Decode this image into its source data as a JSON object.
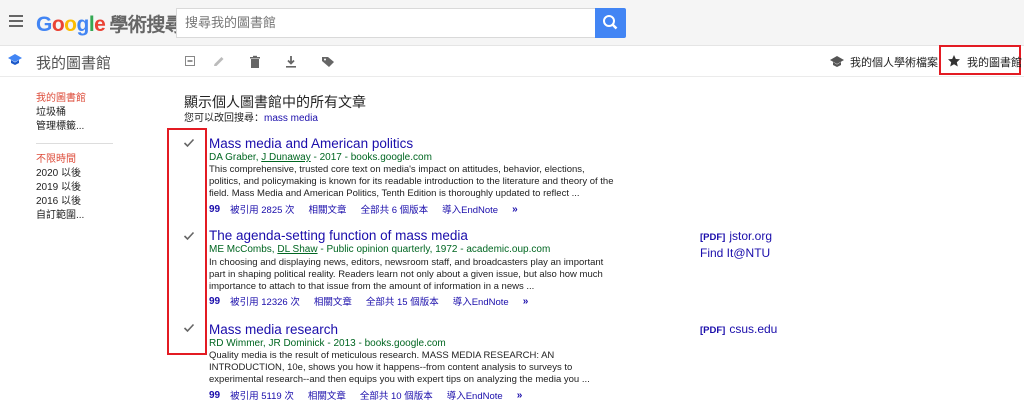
{
  "header": {
    "logo_letters": [
      "G",
      "o",
      "o",
      "g",
      "l",
      "e"
    ],
    "logo_suffix": "學術搜尋",
    "search_placeholder": "搜尋我的圖書館"
  },
  "subbar": {
    "title": "我的圖書館",
    "profile_link": "我的個人學術檔案",
    "mylib_link": "我的圖書館"
  },
  "sidebar": {
    "group1": [
      "我的圖書館",
      "垃圾桶",
      "管理標籤..."
    ],
    "group2": [
      "不限時間",
      "2020 以後",
      "2019 以後",
      "2016 以後",
      "自訂範圍..."
    ]
  },
  "main": {
    "title": "顯示個人圖書館中的所有文章",
    "back_prefix": "您可以改回搜尋：",
    "back_link": "mass media"
  },
  "results": [
    {
      "title": "Mass media and American politics",
      "authors_a": "DA Graber, ",
      "authors_link": "J Dunaway",
      "authors_b": " - 2017 - books.google.com",
      "snippet": "This comprehensive, trusted core text on media's impact on attitudes, behavior, elections, politics, and policymaking is known for its readable introduction to the literature and theory of the field. Mass Media and American Politics, Tenth Edition is thoroughly updated to reflect ...",
      "cited": "被引用 2825 次",
      "related": "相關文章",
      "versions": "全部共 6 個版本",
      "endnote": "導入EndNote",
      "side_pdf": "",
      "side_links": []
    },
    {
      "title": "The agenda-setting function of mass media",
      "authors_a": "ME McCombs, ",
      "authors_link": "DL Shaw",
      "authors_b": " - Public opinion quarterly, 1972 - academic.oup.com",
      "snippet": "In choosing and displaying news, editors, newsroom staff, and broadcasters play an important part in shaping political reality. Readers learn not only about a given issue, but also how much importance to attach to that issue from the amount of information in a news ...",
      "cited": "被引用 12326 次",
      "related": "相關文章",
      "versions": "全部共 15 個版本",
      "endnote": "導入EndNote",
      "side_pdf": "[PDF]",
      "side_links": [
        "jstor.org",
        "Find It@NTU"
      ]
    },
    {
      "title": "Mass media research",
      "authors_a": "RD Wimmer, JR Dominick",
      "authors_link": "",
      "authors_b": " - 2013 - books.google.com",
      "snippet": "Quality media is the result of meticulous research. MASS MEDIA RESEARCH: AN INTRODUCTION, 10e, shows you how it happens--from content analysis to surveys to experimental research--and then equips you with expert tips on analyzing the media you ...",
      "cited": "被引用 5119 次",
      "related": "相關文章",
      "versions": "全部共 10 個版本",
      "endnote": "導入EndNote",
      "side_pdf": "[PDF]",
      "side_links": [
        "csus.edu"
      ]
    }
  ],
  "icons": {
    "link_quote": "99",
    "link_more": "»"
  },
  "colors": {
    "accent_blue": "#4285f4",
    "link": "#1a0dab",
    "green": "#006621",
    "red_highlight": "#e31b23",
    "red_text": "#dd4b39"
  }
}
